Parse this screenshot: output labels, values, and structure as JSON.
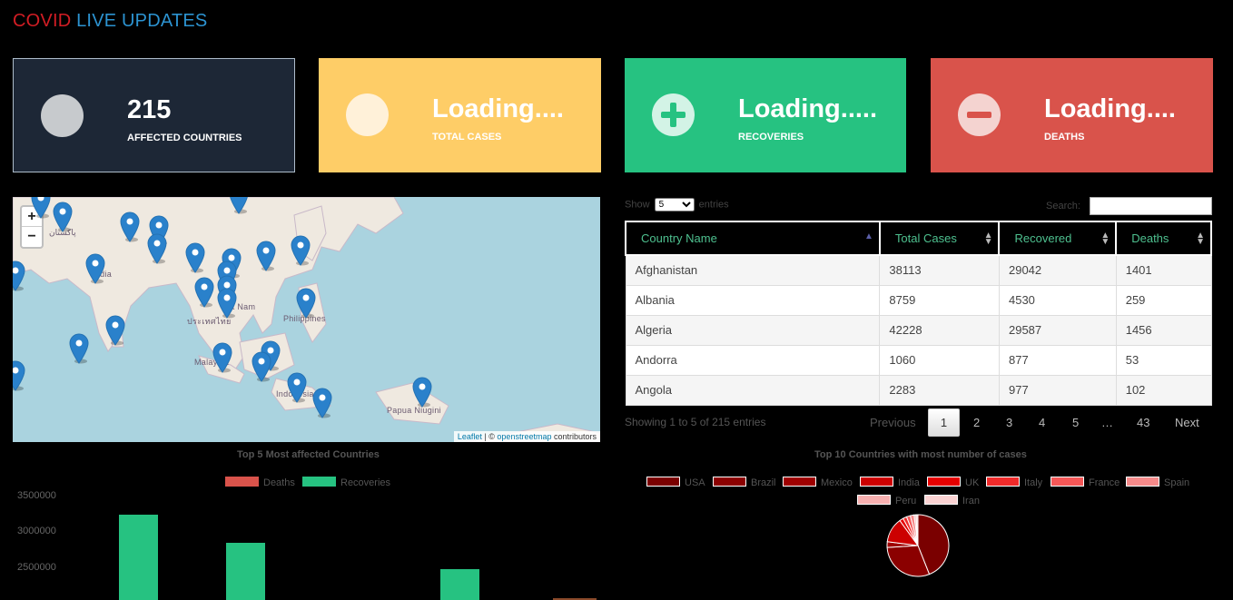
{
  "header": {
    "title_part1": "COVID",
    "title_part2": "LIVE UPDATES"
  },
  "cards": [
    {
      "value": "215",
      "label": "AFFECTED COUNTRIES"
    },
    {
      "value": "Loading....",
      "label": "TOTAL CASES"
    },
    {
      "value": "Loading.....",
      "label": "RECOVERIES"
    },
    {
      "value": "Loading....",
      "label": "DEATHS"
    }
  ],
  "map": {
    "zoom_in": "+",
    "zoom_out": "−",
    "labels": [
      "پاکستان",
      "India",
      "ประเทศไทย",
      "Việt Nam",
      "Philippines",
      "Malaysia",
      "Indonesia",
      "Papua Niugini"
    ],
    "attribution": {
      "leaflet": "Leaflet",
      "sep": " | © ",
      "osm": "openstreetmap",
      "rest": " contributors"
    }
  },
  "table": {
    "show_label": "Show",
    "entries_label": "entries",
    "page_size": "5",
    "search_label": "Search:",
    "columns": [
      "Country Name",
      "Total Cases",
      "Recovered",
      "Deaths"
    ],
    "rows": [
      [
        "Afghanistan",
        "38113",
        "29042",
        "1401"
      ],
      [
        "Albania",
        "8759",
        "4530",
        "259"
      ],
      [
        "Algeria",
        "42228",
        "29587",
        "1456"
      ],
      [
        "Andorra",
        "1060",
        "877",
        "53"
      ],
      [
        "Angola",
        "2283",
        "977",
        "102"
      ]
    ],
    "info": "Showing 1 to 5 of 215 entries",
    "pager": {
      "previous": "Previous",
      "pages": [
        "1",
        "2",
        "3",
        "4",
        "5",
        "…",
        "43"
      ],
      "next": "Next"
    }
  },
  "colors": {
    "deaths": "#d9534b",
    "recoveries": "#26c281",
    "accent_red": "#d21d24",
    "accent_blue": "#2c93d1"
  },
  "chart_data": [
    {
      "type": "bar",
      "title": "Top 5 Most affected Countries",
      "series": [
        {
          "name": "Deaths",
          "values": [
            null,
            null,
            null,
            null,
            null
          ]
        },
        {
          "name": "Recoveries",
          "values": [
            3230000,
            2820000,
            null,
            2450000,
            null
          ]
        }
      ],
      "y_ticks": [
        "3500000",
        "3000000",
        "2500000"
      ],
      "ylim": [
        2000000,
        3500000
      ],
      "legend": "top"
    },
    {
      "type": "pie",
      "title": "Top 10 Countries with most number of cases",
      "categories": [
        "USA",
        "Brazil",
        "Mexico",
        "India",
        "UK",
        "Italy",
        "France",
        "Spain",
        "Peru",
        "Iran"
      ],
      "values": [
        44,
        30,
        3,
        13,
        2,
        2,
        2,
        2,
        1,
        1
      ],
      "colors": [
        "#7a0000",
        "#8b0000",
        "#9e0000",
        "#cc0000",
        "#e60000",
        "#f02a2a",
        "#f55757",
        "#f58a8a",
        "#f7b0b0",
        "#fad2d2"
      ],
      "legend": "top"
    }
  ]
}
